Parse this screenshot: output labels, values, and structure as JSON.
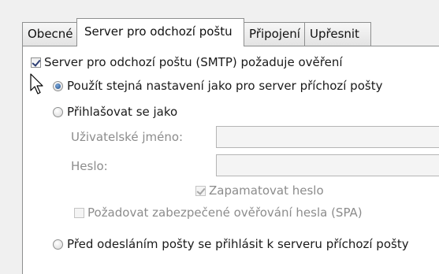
{
  "tabs": [
    {
      "label": "Obecné"
    },
    {
      "label": "Server pro odchozí poštu"
    },
    {
      "label": "Připojení"
    },
    {
      "label": "Upřesnit"
    }
  ],
  "smtp_auth": {
    "label": "Server pro odchozí poštu (SMTP) požaduje ověření",
    "checked": true
  },
  "options": {
    "same_settings": "Použít stejná nastavení jako pro server příchozí pošty",
    "log_on_as": "Přihlašovat se jako",
    "username_label": "Uživatelské jméno:",
    "username_value": "",
    "password_label": "Heslo:",
    "password_value": "",
    "remember_password": "Zapamatovat heslo",
    "require_spa": "Požadovat zabezpečené ověřování hesla (SPA)",
    "logon_before_send": "Před odesláním pošty se přihlásit k serveru příchozí pošty"
  },
  "selected_option": "same_settings",
  "icons": [
    "mouse-pointer-icon"
  ]
}
